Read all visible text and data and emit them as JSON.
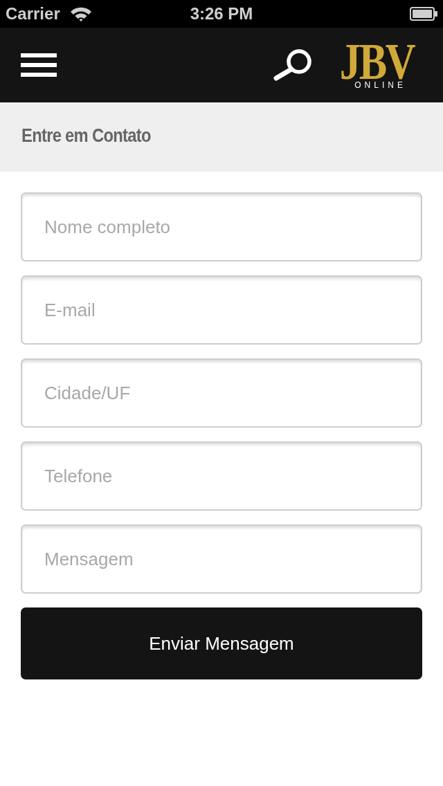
{
  "status_bar": {
    "carrier": "Carrier",
    "time": "3:26 PM"
  },
  "nav_bar": {
    "logo": {
      "wordmark": "JBV",
      "tagline": "ONLINE"
    }
  },
  "header": {
    "title": "Entre em Contato"
  },
  "form": {
    "fields": [
      {
        "placeholder": "Nome completo"
      },
      {
        "placeholder": "E-mail"
      },
      {
        "placeholder": "Cidade/UF"
      },
      {
        "placeholder": "Telefone"
      },
      {
        "placeholder": "Mensagem"
      }
    ],
    "submit": {
      "label": "Enviar Mensagem"
    }
  }
}
